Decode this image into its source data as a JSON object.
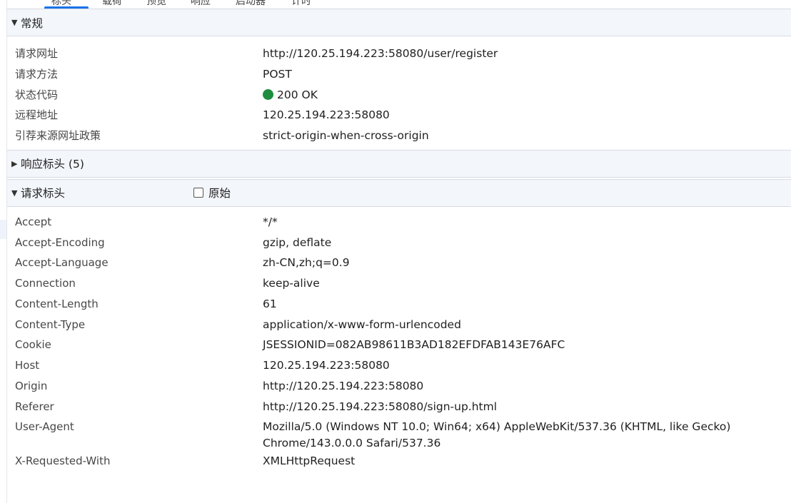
{
  "tabs": [
    {
      "label": "标头"
    },
    {
      "label": "载荷"
    },
    {
      "label": "预览"
    },
    {
      "label": "响应"
    },
    {
      "label": "启动器"
    },
    {
      "label": "计时"
    }
  ],
  "general": {
    "title": "常规",
    "rows": [
      {
        "key": "请求网址",
        "value": "http://120.25.194.223:58080/user/register"
      },
      {
        "key": "请求方法",
        "value": "POST"
      },
      {
        "key": "状态代码",
        "value": "200 OK"
      },
      {
        "key": "远程地址",
        "value": "120.25.194.223:58080"
      },
      {
        "key": "引荐来源网址政策",
        "value": "strict-origin-when-cross-origin"
      }
    ],
    "status_color": "#1e8e3e"
  },
  "response_headers": {
    "title": "响应标头 (5)"
  },
  "request_headers": {
    "title": "请求标头",
    "raw_label": "原始",
    "rows": [
      {
        "key": "Accept",
        "value": "*/*"
      },
      {
        "key": "Accept-Encoding",
        "value": "gzip, deflate"
      },
      {
        "key": "Accept-Language",
        "value": "zh-CN,zh;q=0.9"
      },
      {
        "key": "Connection",
        "value": "keep-alive"
      },
      {
        "key": "Content-Length",
        "value": "61"
      },
      {
        "key": "Content-Type",
        "value": "application/x-www-form-urlencoded"
      },
      {
        "key": "Cookie",
        "value": "JSESSIONID=082AB98611B3AD182EFDFAB143E76AFC"
      },
      {
        "key": "Host",
        "value": "120.25.194.223:58080"
      },
      {
        "key": "Origin",
        "value": "http://120.25.194.223:58080"
      },
      {
        "key": "Referer",
        "value": "http://120.25.194.223:58080/sign-up.html"
      },
      {
        "key": "User-Agent",
        "value": "Mozilla/5.0 (Windows NT 10.0; Win64; x64) AppleWebKit/537.36 (KHTML, like Gecko) Chrome/143.0.0.0 Safari/537.36"
      },
      {
        "key": "X-Requested-With",
        "value": "XMLHttpRequest"
      }
    ]
  },
  "colors": {
    "accent": "#1a73e8",
    "section_bg": "#f3f6fb",
    "border": "#d6dbe3"
  }
}
